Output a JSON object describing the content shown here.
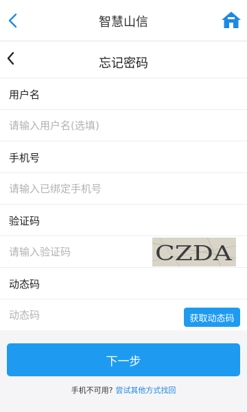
{
  "app": {
    "title": "智慧山信",
    "back_icon": "chevron-left-icon",
    "home_icon": "home-icon",
    "accent": "#1e88e5"
  },
  "page": {
    "title": "忘记密码",
    "back_icon": "chevron-left-icon"
  },
  "form": {
    "username": {
      "label": "用户名",
      "placeholder": "请输入用户名(选填)",
      "value": ""
    },
    "phone": {
      "label": "手机号",
      "placeholder": "请输入已绑定手机号",
      "value": ""
    },
    "captcha": {
      "label": "验证码",
      "placeholder": "请输入验证码",
      "value": "",
      "image_text": "CZDA"
    },
    "sms_code": {
      "label": "动态码",
      "placeholder": "动态码",
      "value": "",
      "send_button": "获取动态码"
    }
  },
  "actions": {
    "next_label": "下一步",
    "button_color": "#1e9bf0"
  },
  "footer": {
    "prompt": "手机不可用?",
    "link": "尝试其他方式找回"
  }
}
